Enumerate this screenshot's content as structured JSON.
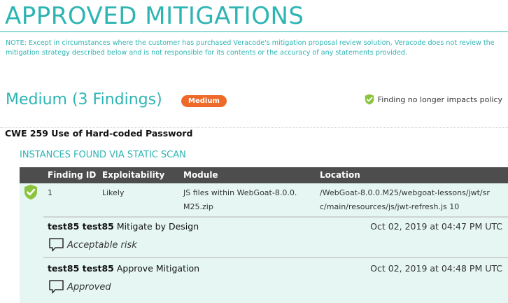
{
  "page": {
    "title": "APPROVED MITIGATIONS",
    "note": "NOTE: Except in circumstances where the customer has purchased Veracode's mitigation proposal review solution, Veracode does not review the mitigation strategy described below and is not responsible for its contents or the accuracy of any statements provided."
  },
  "severity": {
    "heading": "Medium (3 Findings)",
    "badge": "Medium",
    "legend": "Finding no longer impacts policy",
    "colors": {
      "accent": "#2eb5b3",
      "badge": "#ee6a2a",
      "shield": "#8cc43f",
      "panel": "#e5f6f3",
      "header": "#4d4d4d"
    }
  },
  "cwe": {
    "title": "CWE 259 Use of Hard-coded Password"
  },
  "instances": {
    "heading": "INSTANCES FOUND VIA STATIC SCAN",
    "columns": [
      "Finding ID",
      "Exploitability",
      "Module",
      "Location"
    ],
    "rows": [
      {
        "finding_id": "1",
        "exploitability": "Likely",
        "module_lines": [
          "JS files within WebGoat-8.0.0.",
          "M25.zip"
        ],
        "location_lines": [
          "/WebGoat-8.0.0.M25/webgoat-lessons/jwt/sr",
          "c/main/resources/js/jwt-refresh.js 10"
        ],
        "status_icon": "shield-check-icon"
      }
    ]
  },
  "mitigations": [
    {
      "user": "test85 test85",
      "action": "Mitigate by Design",
      "date": "Oct 02, 2019 at 04:47 PM UTC",
      "comment": "Acceptable risk",
      "icon": "comment-icon"
    },
    {
      "user": "test85 test85",
      "action": "Approve Mitigation",
      "date": "Oct 02, 2019 at 04:48 PM UTC",
      "comment": "Approved",
      "icon": "comment-icon"
    }
  ]
}
